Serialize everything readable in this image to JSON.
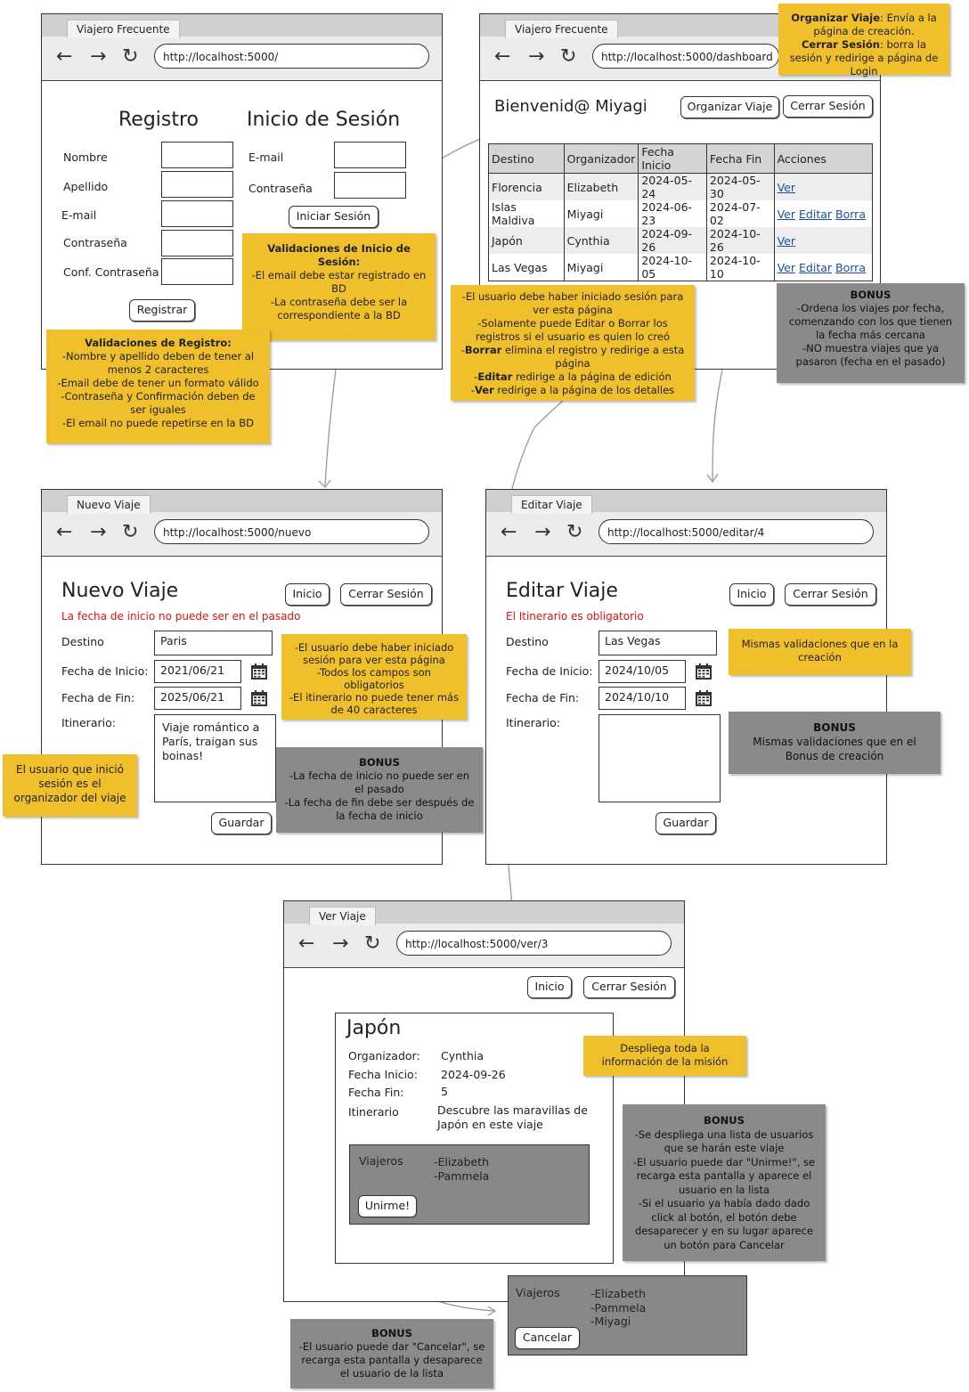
{
  "colors": {
    "note": "#f0bf2c",
    "bonus": "#8a8a8a",
    "error": "#dd1111",
    "link": "#1a4fa0"
  },
  "icons": {
    "back": "arrow-left-icon",
    "forward": "arrow-right-icon",
    "reload": "reload-icon",
    "calendar": "calendar-icon"
  },
  "login_page": {
    "tab": "Viajero Frecuente",
    "url": "http://localhost:5000/",
    "reg_title": "Registro",
    "login_title": "Inicio de Sesión",
    "reg_fields": [
      "Nombre",
      "Apellido",
      "E-mail",
      "Contraseña",
      "Conf. Contraseña"
    ],
    "login_fields": [
      "E-mail",
      "Contraseña"
    ],
    "reg_button": "Registrar",
    "login_button": "Iniciar Sesión"
  },
  "note_login": {
    "title": "Validaciones de Inicio de Sesión:",
    "body": "-El email debe estar registrado en BD\n-La contraseña debe ser la correspondiente a la BD"
  },
  "note_register": {
    "title": "Validaciones de Registro:",
    "body": "-Nombre y apellido deben de tener al menos 2 caracteres\n-Email debe de tener un formato válido\n-Contraseña y Confirmación deben de ser iguales\n-El email no puede repetirse en la BD"
  },
  "dashboard": {
    "tab": "Viajero Frecuente",
    "url": "http://localhost:5000/dashboard",
    "welcome": "Bienvenid@ Miyagi",
    "organize_button": "Organizar Viaje",
    "logout_button": "Cerrar Sesión",
    "headers": [
      "Destino",
      "Organizador",
      "Fecha Inicio",
      "Fecha Fin",
      "Acciones"
    ],
    "rows": [
      {
        "destino": "Florencia",
        "organizador": "Elizabeth",
        "inicio": "2024-05-24",
        "fin": "2024-05-30",
        "actions": [
          "Ver"
        ]
      },
      {
        "destino": "Islas Maldiva",
        "organizador": "Miyagi",
        "inicio": "2024-06-23",
        "fin": "2024-07-02",
        "actions": [
          "Ver",
          "Editar",
          "Borra"
        ]
      },
      {
        "destino": "Japón",
        "organizador": "Cynthia",
        "inicio": "2024-09-26",
        "fin": "2024-10-26",
        "actions": [
          "Ver"
        ]
      },
      {
        "destino": "Las Vegas",
        "organizador": "Miyagi",
        "inicio": "2024-10-05",
        "fin": "2024-10-10",
        "actions": [
          "Ver",
          "Editar",
          "Borra"
        ]
      }
    ]
  },
  "note_dash_top": {
    "b1": "Organizar Viaje",
    "t1": ": Envía a la página de creación.",
    "b2": "Cerrar Sesión",
    "t2": ": borra la sesión y redirige a página de Login"
  },
  "note_dash_rules": {
    "l1": "-El usuario debe haber iniciado sesión para ver esta página",
    "l2": "-Solamente puede Editar o Borrar los registros si el usuario es quien lo creó",
    "b3": "Borrar",
    "l3": " elimina el registro y redirige a esta página",
    "b4": "Editar",
    "l4": " redirige a la página de edición",
    "b5": "Ver",
    "l5": " redirige a la página de los detalles"
  },
  "bonus_dash": {
    "title": "BONUS",
    "body": "-Ordena los viajes por fecha, comenzando con los que tienen la fecha más cercana\n-NO muestra viajes que ya pasaron (fecha en el pasado)"
  },
  "new_trip": {
    "tab": "Nuevo Viaje",
    "url": "http://localhost:5000/nuevo",
    "title": "Nuevo Viaje",
    "home_button": "Inicio",
    "logout_button": "Cerrar Sesión",
    "error": "La fecha  de inicio no puede ser en el pasado",
    "labels": {
      "destino": "Destino",
      "inicio": "Fecha de Inicio:",
      "fin": "Fecha de Fin:",
      "itinerario": "Itinerario:"
    },
    "values": {
      "destino": "Paris",
      "inicio": "2021/06/21",
      "fin": "2025/06/21",
      "itinerario": "Viaje romántico a París, traigan sus boinas!"
    },
    "save_button": "Guardar"
  },
  "note_new": "-El usuario debe haber iniciado sesión para ver esta página\n-Todos los campos son obligatorios\n-El itinerario no puede tener más de 40 caracteres",
  "note_organizer": "El usuario que inició sesión es el organizador del viaje",
  "bonus_new": {
    "title": "BONUS",
    "body": "-La fecha de inicio no puede ser en el pasado\n-La fecha de fin debe ser después de la fecha de inicio"
  },
  "edit_trip": {
    "tab": "Editar Viaje",
    "url": "http://localhost:5000/editar/4",
    "title": "Editar Viaje",
    "home_button": "Inicio",
    "logout_button": "Cerrar Sesión",
    "error": "El Itinerario es obligatorio",
    "labels": {
      "destino": "Destino",
      "inicio": "Fecha de Inicio:",
      "fin": "Fecha de Fin:",
      "itinerario": "Itinerario:"
    },
    "values": {
      "destino": "Las Vegas",
      "inicio": "2024/10/05",
      "fin": "2024/10/10",
      "itinerario": ""
    },
    "save_button": "Guardar"
  },
  "note_edit": "Mismas validaciones que en la creación",
  "bonus_edit": {
    "title": "BONUS",
    "body": "Mismas validaciones que en el Bonus de creación"
  },
  "view_trip": {
    "tab": "Ver Viaje",
    "url": "http://localhost:5000/ver/3",
    "home_button": "Inicio",
    "logout_button": "Cerrar Sesión",
    "title": "Japón",
    "labels": {
      "organizador": "Organizador:",
      "inicio": "Fecha Inicio:",
      "fin": "Fecha Fin:",
      "itinerario": "Itinerario"
    },
    "values": {
      "organizador": "Cynthia",
      "inicio": "2024-09-26",
      "fin": "5",
      "itinerario": "Descubre las maravillas de Japón en este viaje"
    },
    "travelers_label": "Viajeros",
    "travelers": [
      "-Elizabeth",
      "-Pammela"
    ],
    "join_button": "Unirme!"
  },
  "note_view": "Despliega toda la información de la misión",
  "bonus_view": {
    "title": "BONUS",
    "body": "-Se despliega una lista de usuarios que se harán este viaje\n-El usuario puede dar \"Unirme!\", se recarga esta pantalla y aparece el usuario en la lista\n-Si el usuario ya había dado dado click al botón, el botón debe desaparecer y en su lugar aparece un botón para Cancelar"
  },
  "cancel_panel": {
    "travelers_label": "Viajeros",
    "travelers": [
      "-Elizabeth",
      "-Pammela",
      "-Miyagi"
    ],
    "cancel_button": "Cancelar"
  },
  "bonus_cancel": {
    "title": "BONUS",
    "body": "-El usuario puede dar \"Cancelar\", se recarga esta pantalla y desaparece el usuario de la lista"
  }
}
